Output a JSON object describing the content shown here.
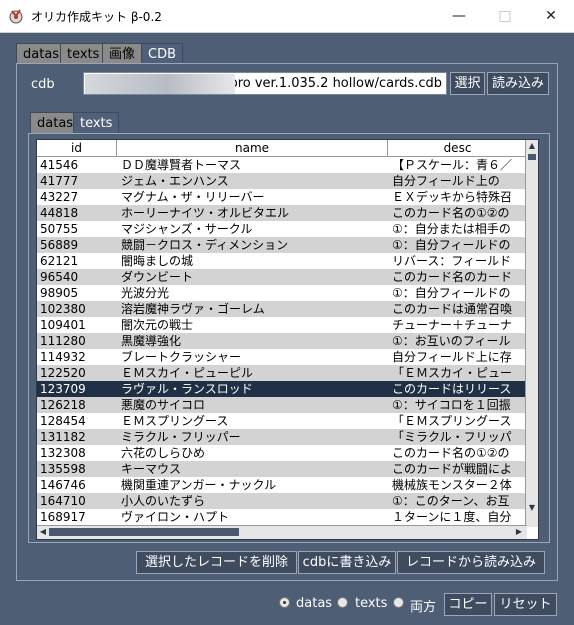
{
  "window": {
    "title": "オリカ作成キット β-0.2"
  },
  "top_tabs": [
    "datas",
    "texts",
    "画像",
    "CDB"
  ],
  "cdb": {
    "label": "cdb",
    "path_visible": "ygopro ver.1.035.2 hollow/cards.cdb",
    "select_button": "選択",
    "load_button": "読み込み"
  },
  "inner_tabs": [
    "datas",
    "texts"
  ],
  "table": {
    "columns": [
      "id",
      "name",
      "desc"
    ],
    "selected_id": "123709",
    "rows": [
      {
        "id": "41546",
        "name": "ＤＤ魔導賢者トーマス",
        "desc": "【Ｐスケール：青６／"
      },
      {
        "id": "41777",
        "name": "ジェム・エンハンス",
        "desc": "自分フィールド上の"
      },
      {
        "id": "43227",
        "name": "マグナム・ザ・リリーバー",
        "desc": "ＥＸデッキから特殊召"
      },
      {
        "id": "44818",
        "name": "ホーリーナイツ・オルビタエル",
        "desc": "このカード名の①②の"
      },
      {
        "id": "50755",
        "name": "マジシャンズ・サークル",
        "desc": "①：自分または相手の"
      },
      {
        "id": "56889",
        "name": "競闘－クロス・ディメンション",
        "desc": "①：自分フィールドの"
      },
      {
        "id": "62121",
        "name": "闇晦ましの城",
        "desc": "リバース：フィールド"
      },
      {
        "id": "96540",
        "name": "ダウンビート",
        "desc": "このカード名のカード"
      },
      {
        "id": "98905",
        "name": "光波分光",
        "desc": "①：自分フィールドの"
      },
      {
        "id": "102380",
        "name": "溶岩魔神ラヴァ・ゴーレム",
        "desc": "このカードは通常召喚"
      },
      {
        "id": "109401",
        "name": "闇次元の戦士",
        "desc": "チューナー＋チューナ"
      },
      {
        "id": "111280",
        "name": "黒魔導強化",
        "desc": "①：お互いのフィール"
      },
      {
        "id": "114932",
        "name": "ブレートクラッシャー",
        "desc": "自分フィールド上に存"
      },
      {
        "id": "122520",
        "name": "ＥＭスカイ・ピューピル",
        "desc": "「ＥＭスカイ・ピュー"
      },
      {
        "id": "123709",
        "name": "ラヴァル・ランスロッド",
        "desc": "このカードはリリース"
      },
      {
        "id": "126218",
        "name": "悪魔のサイコロ",
        "desc": "①：サイコロを１回振"
      },
      {
        "id": "128454",
        "name": "ＥＭスプリングース",
        "desc": "「ＥＭスプリングース"
      },
      {
        "id": "131182",
        "name": "ミラクル・フリッパー",
        "desc": "「ミラクル・フリッパ"
      },
      {
        "id": "132308",
        "name": "六花のしらひめ",
        "desc": "このカード名の①②の"
      },
      {
        "id": "135598",
        "name": "キーマウス",
        "desc": "このカードが戦闘によ"
      },
      {
        "id": "146746",
        "name": "機関重連アンガー・ナックル",
        "desc": "機械族モンスター２体"
      },
      {
        "id": "164710",
        "name": "小人のいたずら",
        "desc": "①：このターン、お互"
      },
      {
        "id": "168917",
        "name": "ヴァイロン・ハプト",
        "desc": "１ターンに１度、自分"
      }
    ]
  },
  "actions": {
    "delete": "選択したレコードを削除",
    "write": "cdbに書き込み",
    "read": "レコードから読み込み"
  },
  "footer": {
    "radios": [
      "datas",
      "texts",
      "両方"
    ],
    "selected_radio": "datas",
    "copy": "コピー",
    "reset": "リセット"
  }
}
